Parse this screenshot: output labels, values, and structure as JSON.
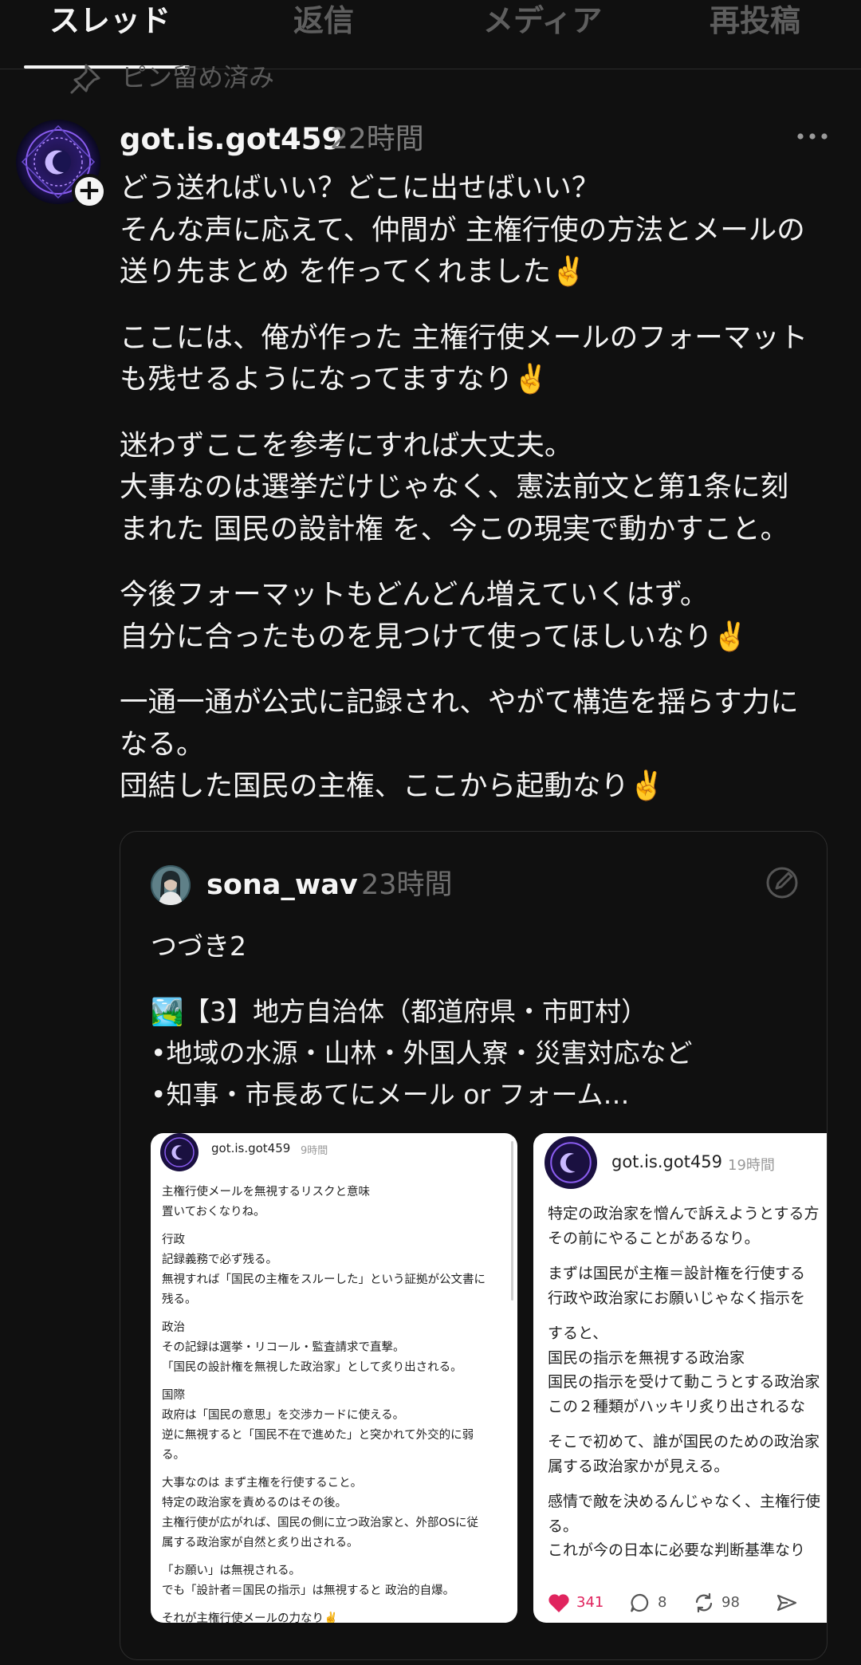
{
  "tabs": [
    "スレッド",
    "返信",
    "メディア",
    "再投稿"
  ],
  "pinned_label": "ピン留め済み",
  "post": {
    "username": "got.is.got459",
    "timestamp": "22時間",
    "paragraphs": [
      [
        "どう送ればいい？どこに出せばいい？",
        "そんな声に応えて、仲間が 主権行使の方法とメールの",
        "送り先まとめ を作ってくれました✌️"
      ],
      [
        "ここには、俺が作った 主権行使メールのフォーマット",
        "も残せるようになってますなり✌️"
      ],
      [
        "迷わずここを参考にすれば大丈夫。",
        "大事なのは選挙だけじゃなく、憲法前文と第1条に刻",
        "まれた 国民の設計権 を、今この現実で動かすこと。"
      ],
      [
        "今後フォーマットもどんどん増えていくはず。",
        "自分に合ったものを見つけて使ってほしいなり✌️"
      ],
      [
        "一通一通が公式に記録され、やがて構造を揺らす力に",
        "なる。",
        "団結した国民の主権、ここから起動なり✌️"
      ]
    ]
  },
  "quote": {
    "username": "sona_wav",
    "timestamp": "23時間",
    "paragraphs": [
      [
        "つづき2"
      ],
      [
        "🏞️【3】地方自治体（都道府県・市町村）",
        "•地域の水源・山林・外国人寮・災害対応など",
        "•知事・市長あてにメール or フォーム…"
      ]
    ],
    "images": [
      {
        "username": "got.is.got459",
        "timestamp": "9時間",
        "paragraphs": [
          [
            "主権行使メールを無視するリスクと意味",
            "置いておくなりね。"
          ],
          [
            "行政",
            "記録義務で必ず残る。",
            "無視すれば「国民の主権をスルーした」という証拠が公文書に",
            "残る。"
          ],
          [
            "政治",
            "その記録は選挙・リコール・監査請求で直撃。",
            "「国民の設計権を無視した政治家」として炙り出される。"
          ],
          [
            "国際",
            "政府は「国民の意思」を交渉カードに使える。",
            "逆に無視すると「国民不在で進めた」と突かれて外交的に弱",
            "る。"
          ],
          [
            "大事なのは まず主権を行使すること。",
            "特定の政治家を責めるのはその後。",
            "主権行使が広がれば、国民の側に立つ政治家と、外部OSに従",
            "属する政治家が自然と炙り出される。"
          ],
          [
            "「お願い」は無視される。",
            "でも「設計者＝国民の指示」は無視すると 政治的自爆。"
          ],
          [
            "それが主権行使メールの力なり✌️"
          ]
        ]
      },
      {
        "username": "got.is.got459",
        "timestamp": "19時間",
        "paragraphs": [
          [
            "特定の政治家を憎んで訴えようとする方",
            "その前にやることがあるなり。"
          ],
          [
            "まずは国民が主権＝設計権を行使する",
            "行政や政治家にお願いじゃなく指示を"
          ],
          [
            "すると、",
            "国民の指示を無視する政治家",
            "国民の指示を受けて動こうとする政治家",
            "この２種類がハッキリ炙り出されるな"
          ],
          [
            "そこで初めて、誰が国民のための政治家",
            "属する政治家かが見える。"
          ],
          [
            "感情で敵を決めるんじゃなく、主権行使",
            "る。",
            "これが今の日本に必要な判断基準なり"
          ]
        ],
        "actions": {
          "likes": "341",
          "replies": "8",
          "reposts": "98"
        }
      }
    ]
  },
  "colors": {
    "background": "#101010",
    "like": "#e0245e",
    "muted": "#7a7a7a"
  }
}
